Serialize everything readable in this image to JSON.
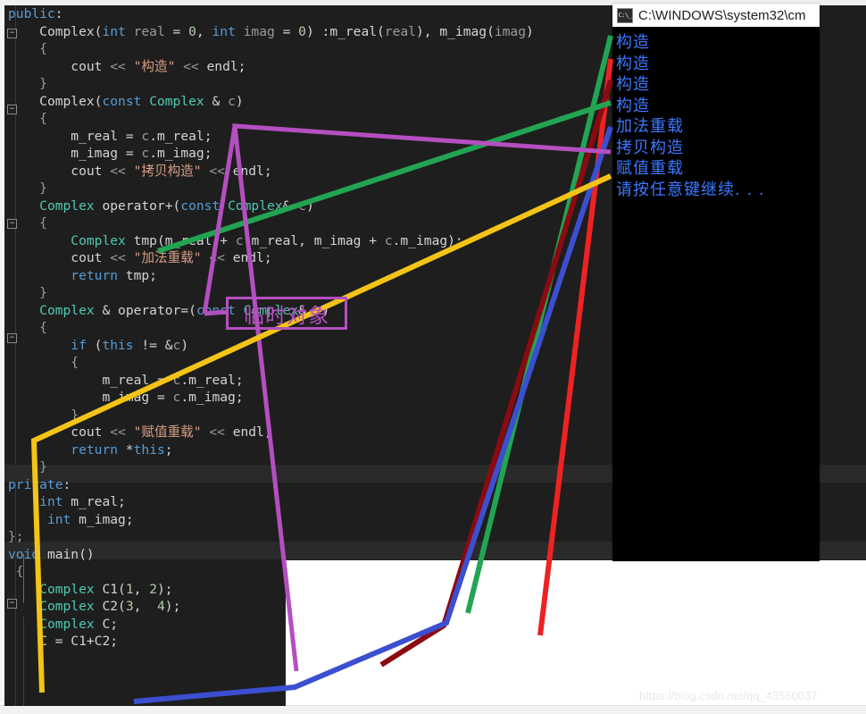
{
  "window": {
    "watermark": "https://blog.csdn.net/qq_43560037"
  },
  "console": {
    "icon": "cmd-icon",
    "title": "C:\\WINDOWS\\system32\\cm",
    "lines": [
      "构造",
      "构造",
      "构造",
      "构造",
      "加法重载",
      "拷贝构造",
      "赋值重载",
      "请按任意键继续. . ."
    ]
  },
  "annotation": {
    "callout_label": "临时对象",
    "callout_color": "#b44fc0",
    "line_colors": {
      "green": "#22a452",
      "red": "#ee2222",
      "darkred": "#8b0a10",
      "green2": "#22a452",
      "blue": "#3b4fd0",
      "purple": "#b44fc0",
      "yellow": "#f3c417"
    }
  },
  "editor": {
    "background": "#1e1e1e",
    "lines": [
      {
        "indent": 0,
        "tokens": [
          {
            "t": "public",
            "c": "kw"
          },
          {
            "t": ":",
            "c": "punc"
          }
        ]
      },
      {
        "indent": 1,
        "tokens": [
          {
            "t": "Complex",
            "c": "id"
          },
          {
            "t": "(",
            "c": "punc"
          },
          {
            "t": "int",
            "c": "kw"
          },
          {
            "t": " real ",
            "c": "dim"
          },
          {
            "t": "= ",
            "c": "punc"
          },
          {
            "t": "0",
            "c": "num"
          },
          {
            "t": ", ",
            "c": "punc"
          },
          {
            "t": "int",
            "c": "kw"
          },
          {
            "t": " imag ",
            "c": "dim"
          },
          {
            "t": "= ",
            "c": "punc"
          },
          {
            "t": "0",
            "c": "num"
          },
          {
            "t": ") :",
            "c": "punc"
          },
          {
            "t": "m_real",
            "c": "id"
          },
          {
            "t": "(",
            "c": "punc"
          },
          {
            "t": "real",
            "c": "dim"
          },
          {
            "t": "), ",
            "c": "punc"
          },
          {
            "t": "m_imag",
            "c": "id"
          },
          {
            "t": "(",
            "c": "punc"
          },
          {
            "t": "imag",
            "c": "dim"
          },
          {
            "t": ")",
            "c": "punc"
          }
        ]
      },
      {
        "indent": 1,
        "tokens": [
          {
            "t": "{",
            "c": "dim"
          }
        ]
      },
      {
        "indent": 2,
        "tokens": [
          {
            "t": "cout ",
            "c": "id"
          },
          {
            "t": "<< ",
            "c": "dim"
          },
          {
            "t": "\"构造\"",
            "c": "str"
          },
          {
            "t": " << ",
            "c": "dim"
          },
          {
            "t": "endl",
            "c": "id"
          },
          {
            "t": ";",
            "c": "punc"
          }
        ]
      },
      {
        "indent": 1,
        "tokens": [
          {
            "t": "}",
            "c": "dim"
          }
        ]
      },
      {
        "indent": 1,
        "tokens": [
          {
            "t": "Complex",
            "c": "id"
          },
          {
            "t": "(",
            "c": "punc"
          },
          {
            "t": "const",
            "c": "kw"
          },
          {
            "t": " ",
            "c": "punc"
          },
          {
            "t": "Complex",
            "c": "typ"
          },
          {
            "t": " & ",
            "c": "punc"
          },
          {
            "t": "c",
            "c": "dim"
          },
          {
            "t": ")",
            "c": "punc"
          }
        ]
      },
      {
        "indent": 1,
        "tokens": [
          {
            "t": "{",
            "c": "dim"
          }
        ]
      },
      {
        "indent": 2,
        "tokens": [
          {
            "t": "m_real ",
            "c": "id"
          },
          {
            "t": "= ",
            "c": "punc"
          },
          {
            "t": "c",
            "c": "dim"
          },
          {
            "t": ".",
            "c": "punc"
          },
          {
            "t": "m_real",
            "c": "id"
          },
          {
            "t": ";",
            "c": "punc"
          }
        ]
      },
      {
        "indent": 2,
        "tokens": [
          {
            "t": "m_imag ",
            "c": "id"
          },
          {
            "t": "= ",
            "c": "punc"
          },
          {
            "t": "c",
            "c": "dim"
          },
          {
            "t": ".",
            "c": "punc"
          },
          {
            "t": "m_imag",
            "c": "id"
          },
          {
            "t": ";",
            "c": "punc"
          }
        ]
      },
      {
        "indent": 2,
        "tokens": [
          {
            "t": "cout ",
            "c": "id"
          },
          {
            "t": "<< ",
            "c": "dim"
          },
          {
            "t": "\"拷贝构造\"",
            "c": "str"
          },
          {
            "t": " << ",
            "c": "dim"
          },
          {
            "t": "endl",
            "c": "id"
          },
          {
            "t": ";",
            "c": "punc"
          }
        ]
      },
      {
        "indent": 1,
        "tokens": [
          {
            "t": "}",
            "c": "dim"
          }
        ]
      },
      {
        "indent": 1,
        "tokens": [
          {
            "t": "Complex",
            "c": "typ"
          },
          {
            "t": " operator+(",
            "c": "id"
          },
          {
            "t": "const",
            "c": "kw"
          },
          {
            "t": " ",
            "c": "punc"
          },
          {
            "t": "Complex",
            "c": "typ"
          },
          {
            "t": "& ",
            "c": "punc"
          },
          {
            "t": "c",
            "c": "dim"
          },
          {
            "t": ")",
            "c": "punc"
          }
        ]
      },
      {
        "indent": 1,
        "tokens": [
          {
            "t": "{",
            "c": "dim"
          }
        ]
      },
      {
        "indent": 2,
        "tokens": [
          {
            "t": "Complex",
            "c": "typ"
          },
          {
            "t": " tmp(",
            "c": "id"
          },
          {
            "t": "m_real ",
            "c": "id"
          },
          {
            "t": "+ ",
            "c": "punc"
          },
          {
            "t": "c",
            "c": "dim"
          },
          {
            "t": ".",
            "c": "punc"
          },
          {
            "t": "m_real",
            "c": "id"
          },
          {
            "t": ", ",
            "c": "punc"
          },
          {
            "t": "m_imag ",
            "c": "id"
          },
          {
            "t": "+ ",
            "c": "punc"
          },
          {
            "t": "c",
            "c": "dim"
          },
          {
            "t": ".",
            "c": "punc"
          },
          {
            "t": "m_imag",
            "c": "id"
          },
          {
            "t": ");",
            "c": "punc"
          }
        ]
      },
      {
        "indent": 2,
        "tokens": [
          {
            "t": "cout ",
            "c": "id"
          },
          {
            "t": "<< ",
            "c": "dim"
          },
          {
            "t": "\"加法重载\"",
            "c": "str"
          },
          {
            "t": " << ",
            "c": "dim"
          },
          {
            "t": "endl",
            "c": "id"
          },
          {
            "t": ";",
            "c": "punc"
          }
        ]
      },
      {
        "indent": 2,
        "tokens": [
          {
            "t": "return",
            "c": "kw"
          },
          {
            "t": " tmp;",
            "c": "id"
          }
        ]
      },
      {
        "indent": 1,
        "tokens": [
          {
            "t": "}",
            "c": "dim"
          }
        ]
      },
      {
        "indent": 1,
        "tokens": [
          {
            "t": "Complex",
            "c": "typ"
          },
          {
            "t": " & operator=(",
            "c": "id"
          },
          {
            "t": "const",
            "c": "kw"
          },
          {
            "t": " ",
            "c": "punc"
          },
          {
            "t": "Complex",
            "c": "typ"
          },
          {
            "t": "& ",
            "c": "punc"
          },
          {
            "t": "c",
            "c": "dim"
          },
          {
            "t": ")",
            "c": "punc"
          }
        ]
      },
      {
        "indent": 1,
        "tokens": [
          {
            "t": "{",
            "c": "dim"
          }
        ]
      },
      {
        "indent": 2,
        "tokens": [
          {
            "t": "if",
            "c": "kw"
          },
          {
            "t": " (",
            "c": "punc"
          },
          {
            "t": "this",
            "c": "kw"
          },
          {
            "t": " != &",
            "c": "punc"
          },
          {
            "t": "c",
            "c": "dim"
          },
          {
            "t": ")",
            "c": "punc"
          }
        ]
      },
      {
        "indent": 2,
        "tokens": [
          {
            "t": "{",
            "c": "dim"
          }
        ]
      },
      {
        "indent": 3,
        "tokens": [
          {
            "t": "m_real ",
            "c": "id"
          },
          {
            "t": "= ",
            "c": "punc"
          },
          {
            "t": "c",
            "c": "dim"
          },
          {
            "t": ".",
            "c": "punc"
          },
          {
            "t": "m_real",
            "c": "id"
          },
          {
            "t": ";",
            "c": "punc"
          }
        ]
      },
      {
        "indent": 3,
        "tokens": [
          {
            "t": "m_imag ",
            "c": "id"
          },
          {
            "t": "= ",
            "c": "punc"
          },
          {
            "t": "c",
            "c": "dim"
          },
          {
            "t": ".",
            "c": "punc"
          },
          {
            "t": "m_imag",
            "c": "id"
          },
          {
            "t": ";",
            "c": "punc"
          }
        ]
      },
      {
        "indent": 2,
        "tokens": [
          {
            "t": "}",
            "c": "dim"
          }
        ]
      },
      {
        "indent": 2,
        "tokens": [
          {
            "t": "cout ",
            "c": "id"
          },
          {
            "t": "<< ",
            "c": "dim"
          },
          {
            "t": "\"赋值重载\"",
            "c": "str"
          },
          {
            "t": " << ",
            "c": "dim"
          },
          {
            "t": "endl",
            "c": "id"
          },
          {
            "t": ";",
            "c": "punc"
          }
        ]
      },
      {
        "indent": 2,
        "tokens": [
          {
            "t": "return",
            "c": "kw"
          },
          {
            "t": " *",
            "c": "punc"
          },
          {
            "t": "this",
            "c": "kw"
          },
          {
            "t": ";",
            "c": "punc"
          }
        ]
      },
      {
        "indent": 1,
        "tokens": [
          {
            "t": "}",
            "c": "dim"
          }
        ]
      },
      {
        "indent": 0,
        "tokens": [
          {
            "t": "private",
            "c": "kw"
          },
          {
            "t": ":",
            "c": "punc"
          }
        ]
      },
      {
        "indent": 1,
        "tokens": [
          {
            "t": "int",
            "c": "kw"
          },
          {
            "t": " m_real;",
            "c": "id"
          }
        ]
      },
      {
        "indent": 1,
        "tokens": [
          {
            "t": " ",
            "c": "punc"
          },
          {
            "t": "int",
            "c": "kw"
          },
          {
            "t": " m_imag;",
            "c": "id"
          }
        ]
      },
      {
        "indent": 0,
        "tokens": [
          {
            "t": "};",
            "c": "dim"
          }
        ]
      },
      {
        "indent": 0,
        "tokens": [
          {
            "t": "void",
            "c": "kw"
          },
          {
            "t": " main()",
            "c": "id"
          }
        ]
      },
      {
        "indent": 0,
        "tokens": [
          {
            "t": " {",
            "c": "dim"
          }
        ]
      },
      {
        "indent": 1,
        "tokens": [
          {
            "t": "Complex",
            "c": "typ"
          },
          {
            "t": " C1(",
            "c": "id"
          },
          {
            "t": "1",
            "c": "num"
          },
          {
            "t": ", ",
            "c": "punc"
          },
          {
            "t": "2",
            "c": "num"
          },
          {
            "t": ");",
            "c": "punc"
          }
        ]
      },
      {
        "indent": 1,
        "tokens": [
          {
            "t": "Complex",
            "c": "typ"
          },
          {
            "t": " C2(",
            "c": "id"
          },
          {
            "t": "3",
            "c": "num"
          },
          {
            "t": ",  ",
            "c": "punc"
          },
          {
            "t": "4",
            "c": "num"
          },
          {
            "t": ");",
            "c": "punc"
          }
        ]
      },
      {
        "indent": 1,
        "tokens": [
          {
            "t": "Complex",
            "c": "typ"
          },
          {
            "t": " C;",
            "c": "id"
          }
        ]
      },
      {
        "indent": 1,
        "tokens": [
          {
            "t": "C = C1+C2;",
            "c": "id"
          }
        ]
      }
    ]
  }
}
